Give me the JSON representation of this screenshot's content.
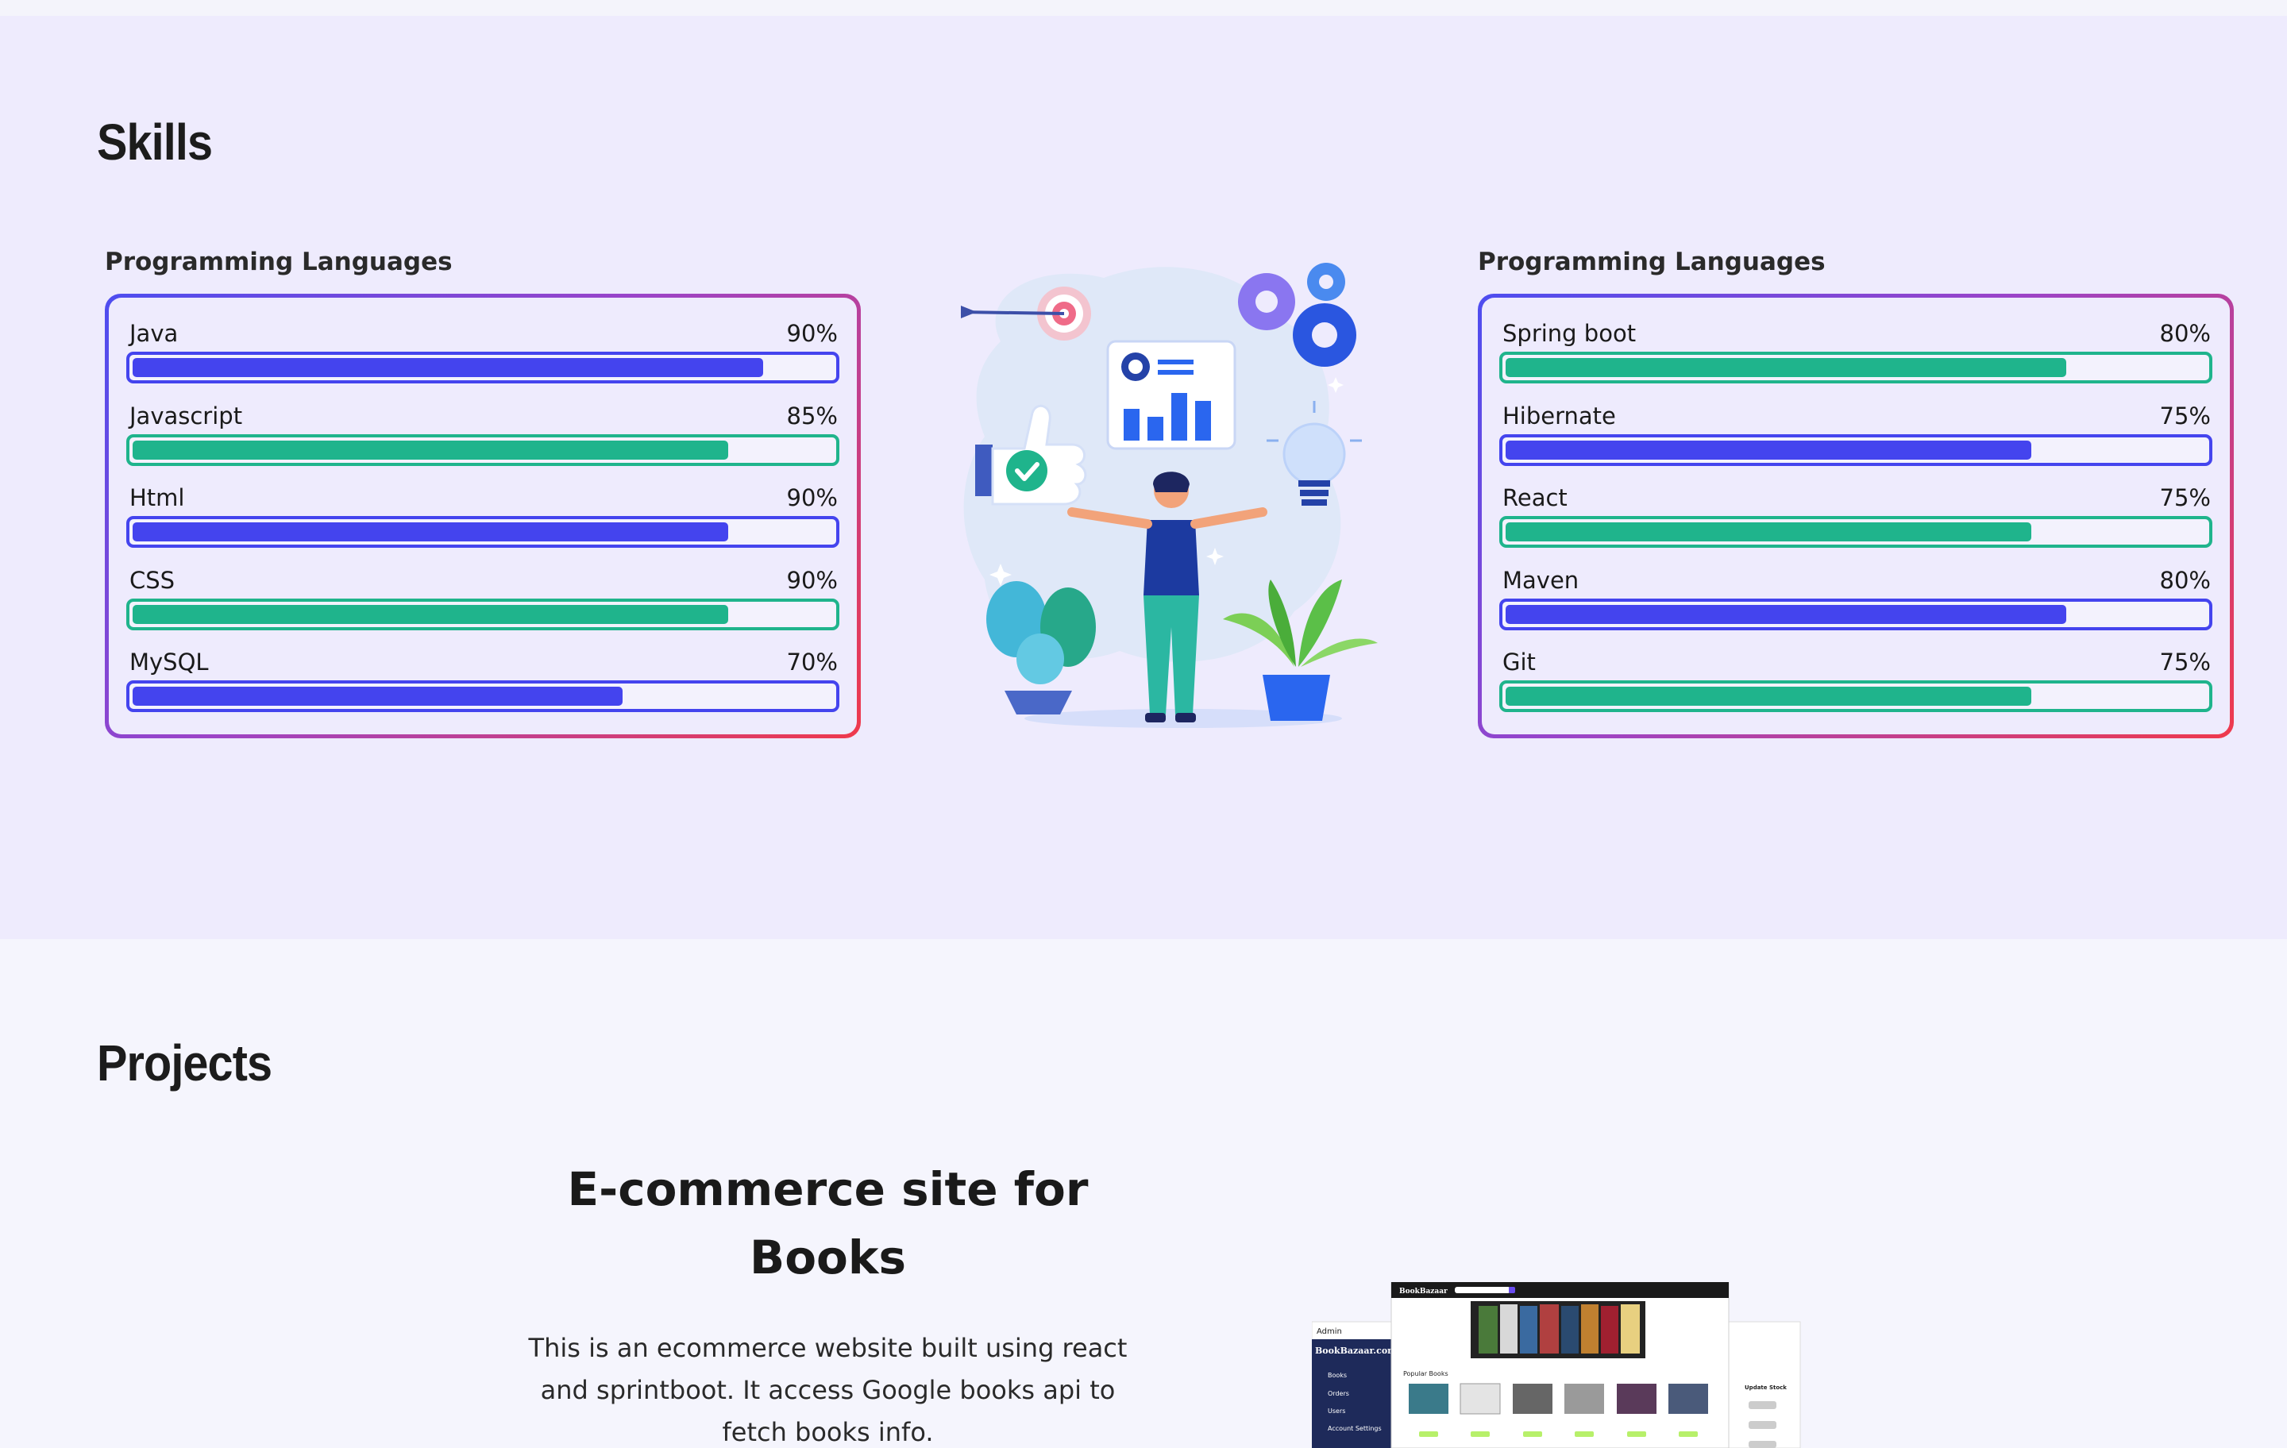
{
  "skills": {
    "title": "Skills",
    "groups": [
      {
        "title": "Programming Languages",
        "items": [
          {
            "name": "Java",
            "percent_label": "90%",
            "level": 0.9,
            "color": "#4444ee"
          },
          {
            "name": "Javascript",
            "percent_label": "85%",
            "level": 0.85,
            "color": "#1fb48c"
          },
          {
            "name": "Html",
            "percent_label": "90%",
            "level": 0.85,
            "color": "#4444ee"
          },
          {
            "name": "CSS",
            "percent_label": "90%",
            "level": 0.85,
            "color": "#1fb48c"
          },
          {
            "name": "MySQL",
            "percent_label": "70%",
            "level": 0.7,
            "color": "#4444ee"
          }
        ]
      },
      {
        "title": "Programming Languages",
        "items": [
          {
            "name": "Spring boot",
            "percent_label": "80%",
            "level": 0.8,
            "color": "#1fb48c"
          },
          {
            "name": "Hibernate",
            "percent_label": "75%",
            "level": 0.75,
            "color": "#4444ee"
          },
          {
            "name": "React",
            "percent_label": "75%",
            "level": 0.75,
            "color": "#1fb48c"
          },
          {
            "name": "Maven",
            "percent_label": "80%",
            "level": 0.8,
            "color": "#4444ee"
          },
          {
            "name": "Git",
            "percent_label": "75%",
            "level": 0.75,
            "color": "#1fb48c"
          }
        ]
      }
    ]
  },
  "projects": {
    "title": "Projects",
    "items": [
      {
        "title": "E-commerce site for Books",
        "description": "This is an ecommerce website built using react and sprintboot. It access Google books api to fetch books info.",
        "mockup": {
          "admin_label": "Admin",
          "admin_brand": "BookBazaar.com",
          "admin_menu": [
            "Books",
            "Orders",
            "Users",
            "Account Settings"
          ],
          "store_brand": "BookBazaar",
          "section_label": "Popular Books",
          "side_label": "Update Stock"
        }
      }
    ]
  },
  "colors": {
    "skills_bg": "#eeebfd",
    "projects_bg": "#f5f5fd",
    "blue_bar": "#4444ee",
    "green_bar": "#1fb48c",
    "card_gradient": [
      "#4d4df0",
      "#9b44c8",
      "#ef3a4c"
    ]
  }
}
